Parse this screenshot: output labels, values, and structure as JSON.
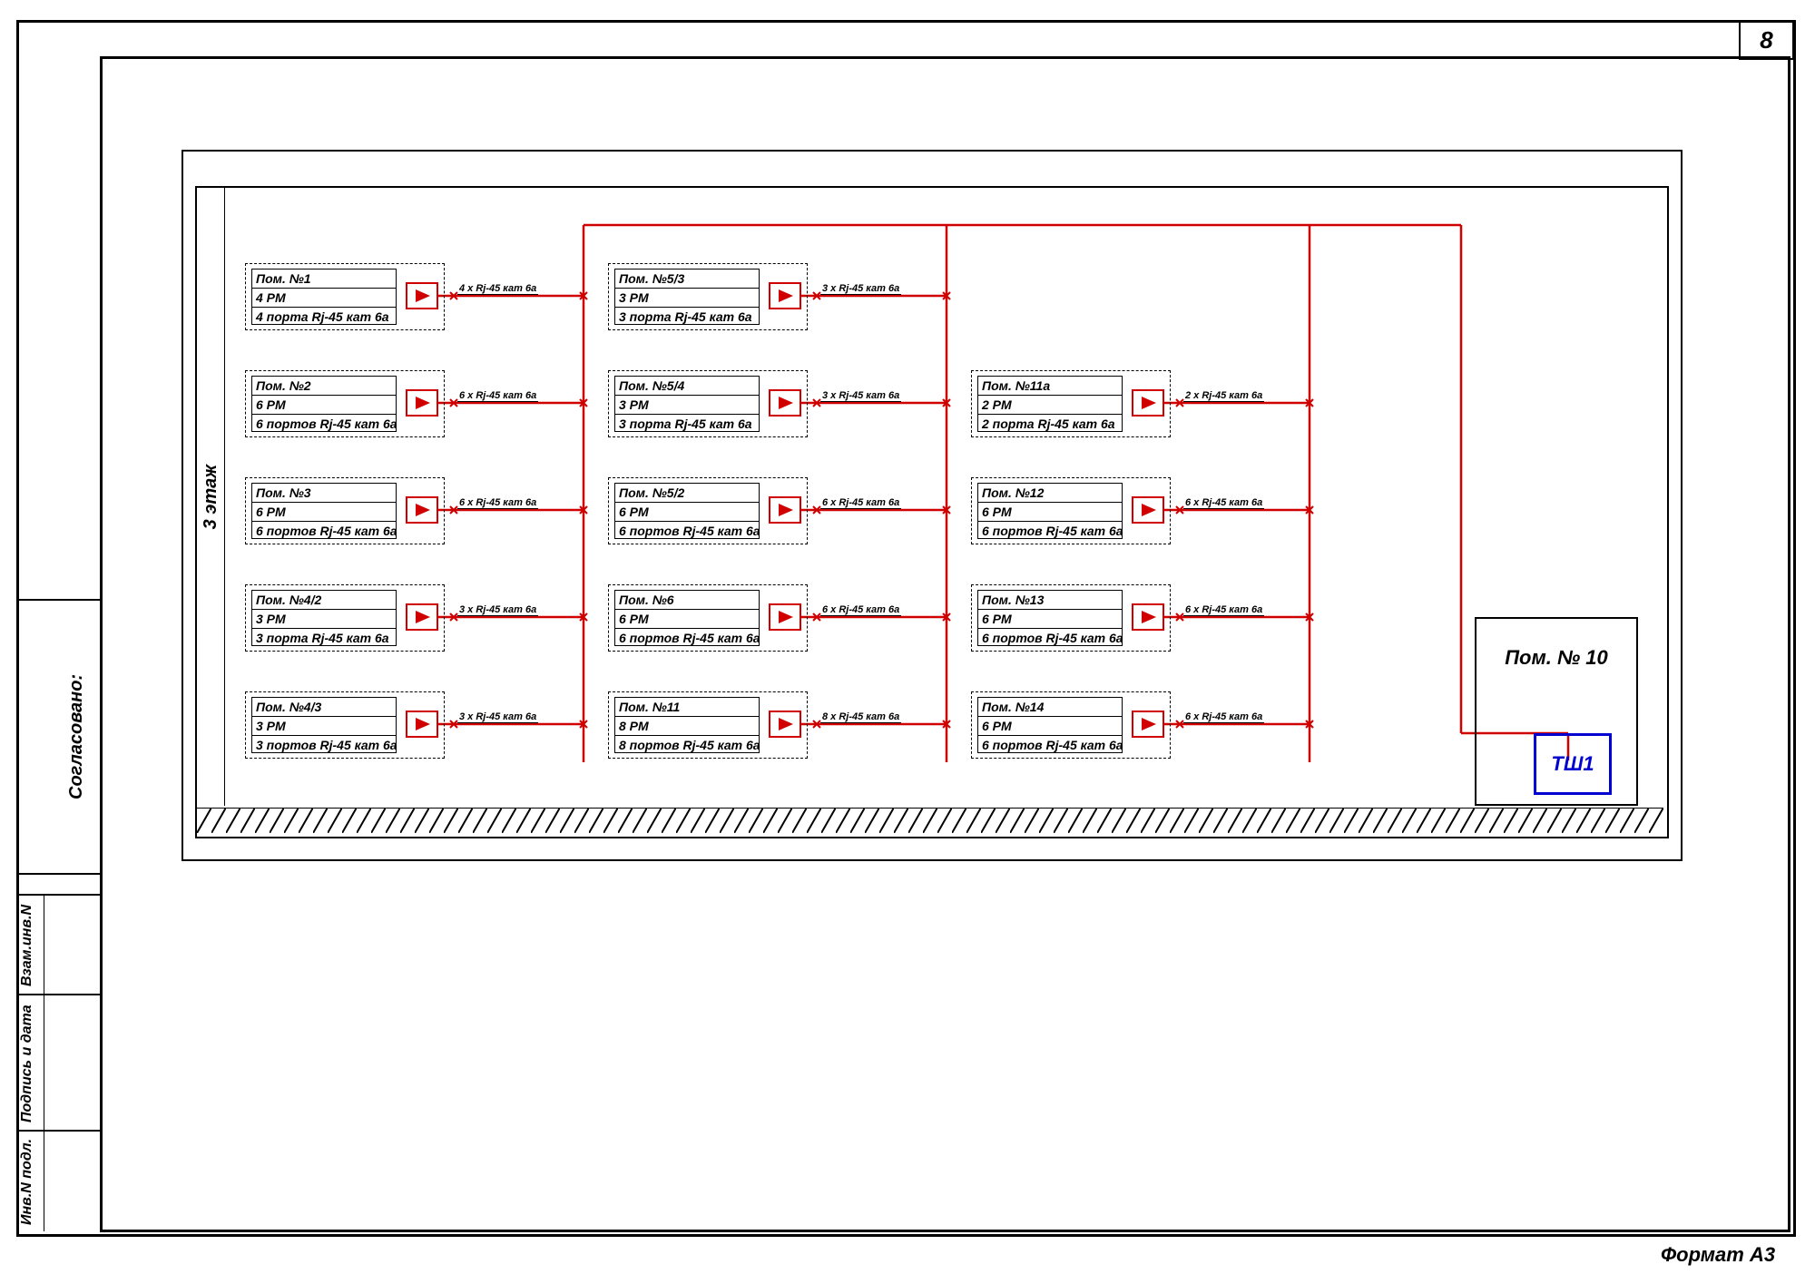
{
  "sheet": {
    "number": "8",
    "format": "Формат А3"
  },
  "left_stamp": {
    "agreed": "Согласовано:",
    "inv_vzam": "Взам.инв.N",
    "sign_date": "Подпись и дата",
    "inv_podl": "Инв.N подл."
  },
  "floor_label": "3 этаж",
  "rooms": {
    "c1": [
      {
        "title": "Пом. №1",
        "pm": "4 РМ",
        "ports": "4 порта Rj-45 кат 6а",
        "cable": "4 х Rj-45 кат 6а"
      },
      {
        "title": "Пом. №2",
        "pm": "6 РМ",
        "ports": "6 портов Rj-45 кат 6а",
        "cable": "6 х Rj-45 кат 6а"
      },
      {
        "title": "Пом. №3",
        "pm": "6 РМ",
        "ports": "6 портов Rj-45 кат 6а",
        "cable": "6 х Rj-45 кат 6а"
      },
      {
        "title": "Пом. №4/2",
        "pm": "3 РМ",
        "ports": "3 порта Rj-45 кат 6а",
        "cable": "3 х Rj-45 кат 6а"
      },
      {
        "title": "Пом. №4/3",
        "pm": "3 РМ",
        "ports": "3 портов Rj-45 кат 6а",
        "cable": "3 х Rj-45 кат 6а"
      }
    ],
    "c2": [
      {
        "title": "Пом. №5/3",
        "pm": "3 РМ",
        "ports": "3 порта Rj-45 кат 6а",
        "cable": "3 х Rj-45 кат 6а"
      },
      {
        "title": "Пом. №5/4",
        "pm": "3 РМ",
        "ports": "3 порта Rj-45 кат 6а",
        "cable": "3 х Rj-45 кат 6а"
      },
      {
        "title": "Пом. №5/2",
        "pm": "6 РМ",
        "ports": "6 портов Rj-45 кат 6а",
        "cable": "6 х Rj-45 кат 6а"
      },
      {
        "title": "Пом. №6",
        "pm": "6 РМ",
        "ports": "6 портов Rj-45 кат 6а",
        "cable": "6 х Rj-45 кат 6а"
      },
      {
        "title": "Пом. №11",
        "pm": "8 РМ",
        "ports": "8 портов Rj-45 кат 6а",
        "cable": "8 х Rj-45 кат 6а"
      }
    ],
    "c3": [
      {
        "title": "Пом. №11а",
        "pm": "2 РМ",
        "ports": "2 порта Rj-45 кат 6а",
        "cable": "2 х Rj-45 кат 6а"
      },
      {
        "title": "Пом. №12",
        "pm": "6 РМ",
        "ports": "6 портов Rj-45 кат 6а",
        "cable": "6 х Rj-45 кат 6а"
      },
      {
        "title": "Пом. №13",
        "pm": "6 РМ",
        "ports": "6 портов Rj-45 кат 6а",
        "cable": "6 х Rj-45 кат 6а"
      },
      {
        "title": "Пом. №14",
        "pm": "6 РМ",
        "ports": "6 портов Rj-45 кат 6а",
        "cable": "6 х Rj-45 кат 6а"
      }
    ]
  },
  "room10_label": "Пом. № 10",
  "tsh_label": "ТШ1"
}
